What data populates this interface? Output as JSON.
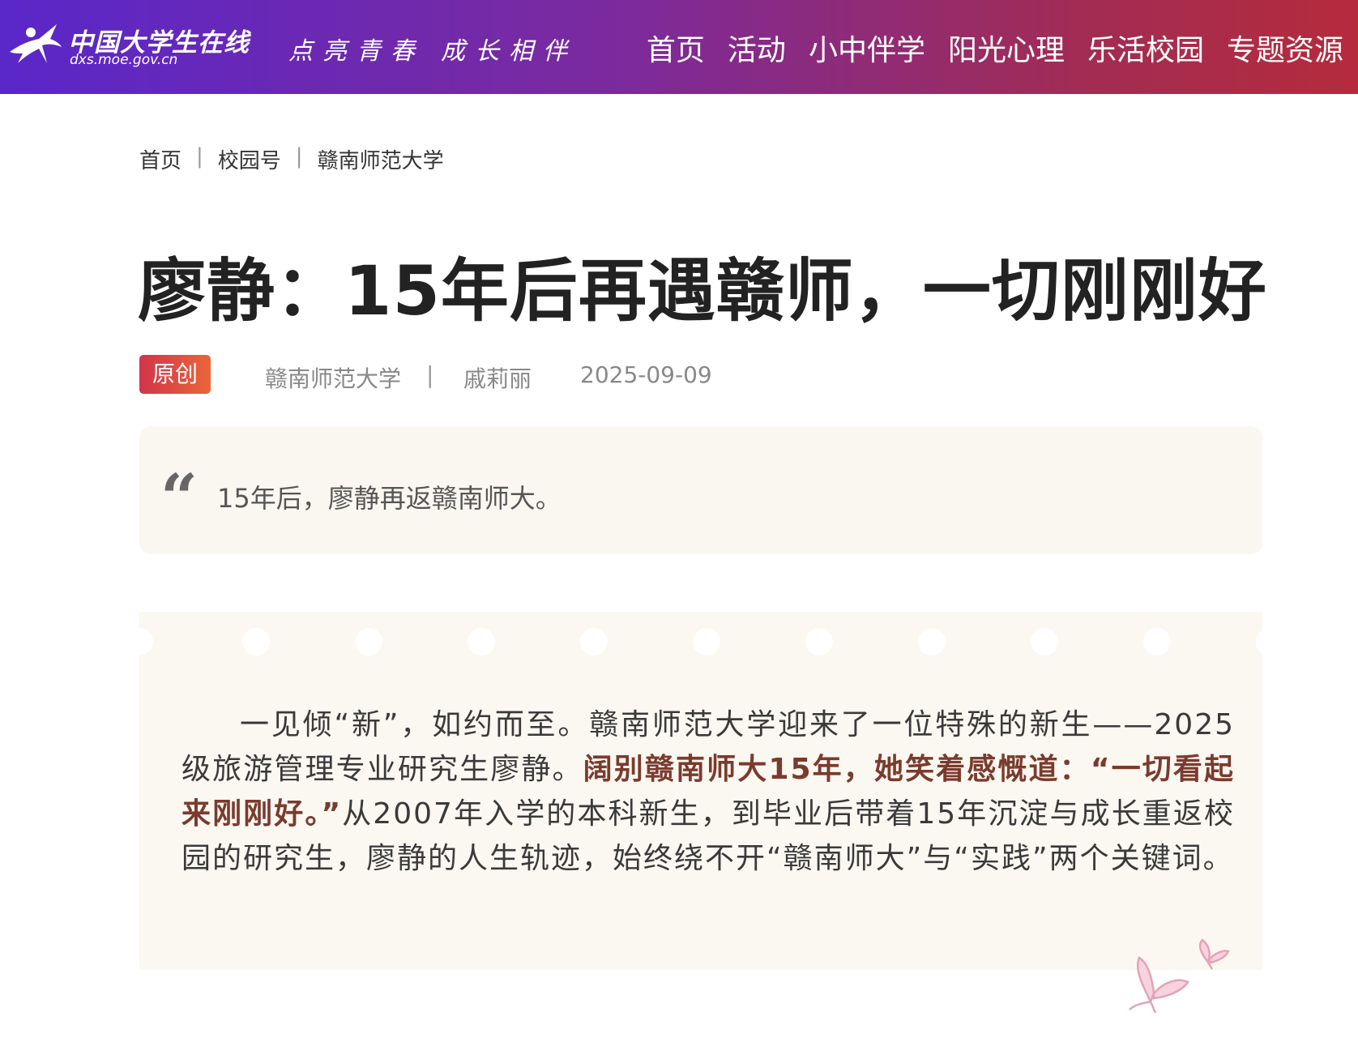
{
  "header": {
    "logo_title": "中国大学生在线",
    "logo_url_text": "dxs.moe.gov.cn",
    "slogan_1": "点亮青春",
    "slogan_2": "成长相伴",
    "nav": [
      "首页",
      "活动",
      "小中伴学",
      "阳光心理",
      "乐活校园",
      "专题资源"
    ]
  },
  "breadcrumb": [
    "首页",
    "校园号",
    "赣南师范大学"
  ],
  "breadcrumb_sep": "|",
  "article": {
    "title": "廖静：15年后再遇赣师，一切刚刚好",
    "badge": "原创",
    "source": "赣南师范大学",
    "meta_sep": "|",
    "author": "戚莉丽",
    "date": "2025-09-09",
    "summary": "15年后，廖静再返赣南师大。",
    "paragraph": {
      "part1": "一见倾“新”，如约而至。赣南师范大学迎来了一位特殊的新生——2025级旅游管理专业研究生廖静。",
      "highlight": "阔别赣南师大15年，她笑着感慨道：“一切看起来刚刚好。”",
      "part2": "从2007年入学的本科新生，到毕业后带着15年沉淀与成长重返校园的研究生，廖静的人生轨迹，始终绕不开“赣南师大”与“实践”两个关键词。"
    }
  },
  "colors": {
    "header_gradient_start": "#5a27c9",
    "header_gradient_end": "#b52b3c",
    "badge_start": "#d2344a",
    "badge_end": "#e9663a",
    "highlight_text": "#7a3b2e",
    "card_background": "#fbf8f1"
  },
  "icons": {
    "logo": "runner-logo-icon",
    "quote": "quote-mark-icon",
    "decoration": "butterfly-icon"
  }
}
